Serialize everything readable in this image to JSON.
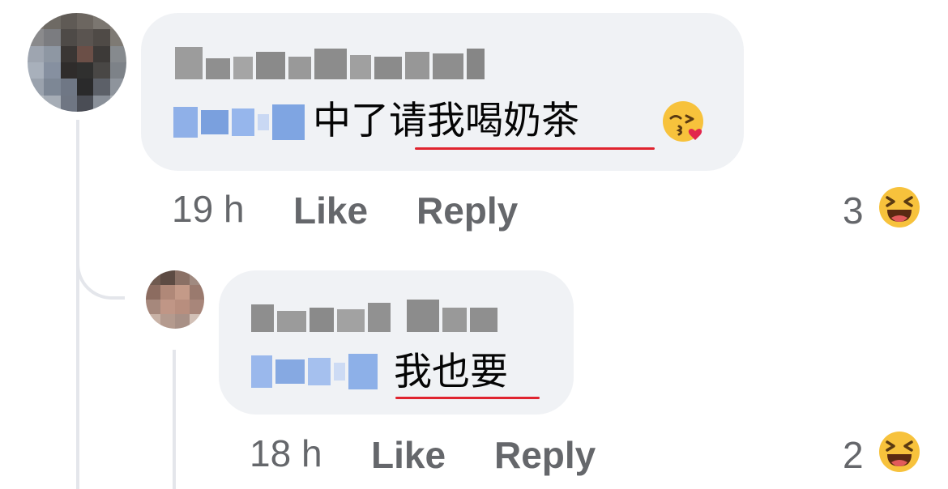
{
  "comments": [
    {
      "message_plain": "中了",
      "message_underlined": "请我喝奶茶",
      "emoji": "kissing-face-with-heart-icon",
      "time": "19 h",
      "like_label": "Like",
      "reply_label": "Reply",
      "reaction_count": "3",
      "reaction_emoji": "laughing-face-icon"
    },
    {
      "message_plain": "",
      "message_underlined": "我也要",
      "time": "18 h",
      "like_label": "Like",
      "reply_label": "Reply",
      "reaction_count": "2",
      "reaction_emoji": "laughing-face-icon"
    }
  ],
  "colors": {
    "bubble": "#f0f2f5",
    "secondary_text": "#65676b",
    "spell_underline": "#e0242f",
    "thread_line": "#e4e6eb"
  }
}
